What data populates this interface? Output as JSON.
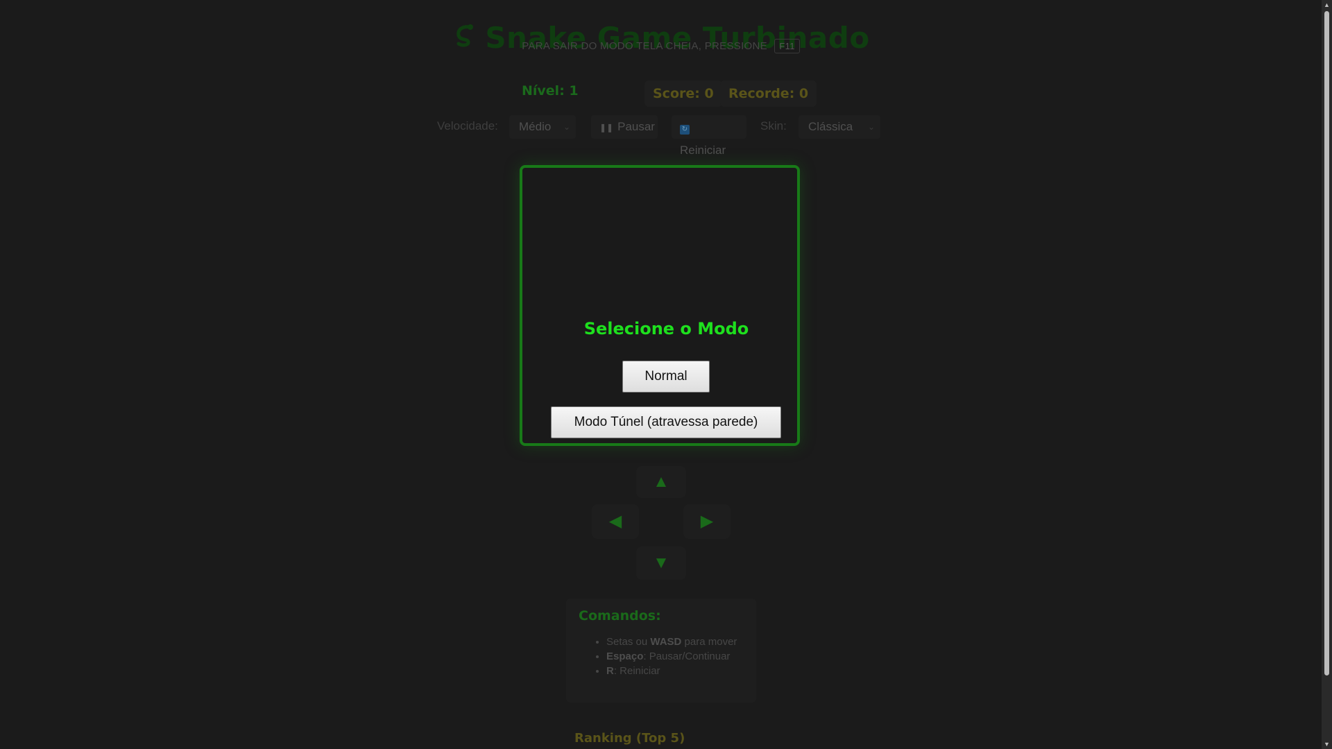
{
  "header": {
    "title": "Snake Game Turbinado",
    "title_icon": "snake-icon",
    "fullscreen_notice": "PARA SAIR DO MODO TELA CHEIA, PRESSIONE",
    "fullscreen_key": "F11"
  },
  "stats": {
    "level": "Nível: 1",
    "score": "Score: 0",
    "record": "Recorde: 0"
  },
  "controls": {
    "speed_label": "Velocidade:",
    "speed_value": "Médio",
    "pause_label": "Pausar",
    "pause_icon": "pause-icon",
    "restart_label": "Reiniciar",
    "restart_icon": "refresh-icon",
    "skin_label": "Skin:",
    "skin_value": "Clássica"
  },
  "modal": {
    "title": "Selecione o Modo",
    "normal_label": "Normal",
    "tunnel_label": "Modo Túnel (atravessa parede)"
  },
  "arrows": {
    "up": "▲",
    "left": "◀",
    "right": "▶",
    "down": "▼"
  },
  "commands": {
    "title": "Comandos:",
    "items": [
      {
        "key": "WASD",
        "prefix": "Setas ou ",
        "suffix": " para mover"
      },
      {
        "key": "Espaço",
        "prefix": "",
        "suffix": ": Pausar/Continuar"
      },
      {
        "key": "R",
        "prefix": "",
        "suffix": ": Reiniciar"
      }
    ]
  },
  "ranking": {
    "title": "Ranking (Top 5)"
  },
  "colors": {
    "background": "#1b1b1b",
    "accent_green": "#1ee01e",
    "board_border": "#187a18",
    "gold": "#5a5419"
  }
}
